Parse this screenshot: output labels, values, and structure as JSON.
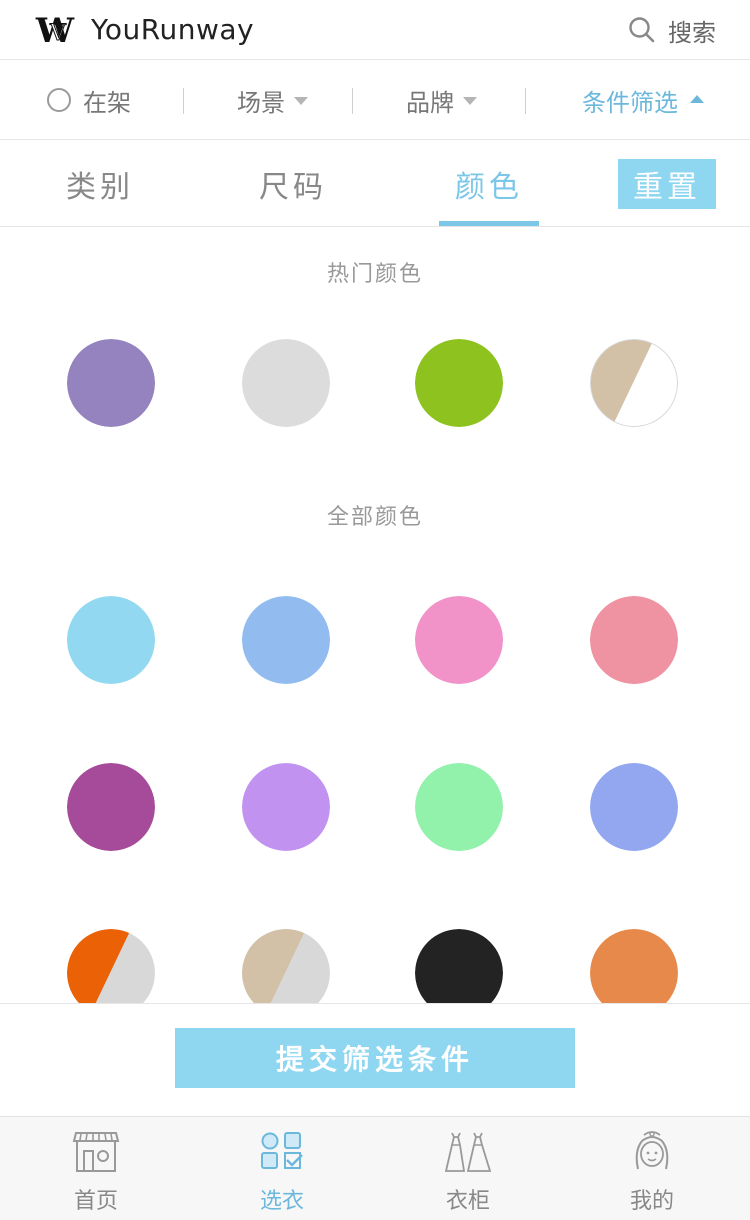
{
  "header": {
    "app_title": "YouRunway",
    "logo_icon": "yourunway-logo-icon",
    "search_label": "搜索",
    "search_icon": "search-icon"
  },
  "filter_bar": {
    "in_stock_label": "在架",
    "scene_label": "场景",
    "brand_label": "品牌",
    "conditions_label": "条件筛选"
  },
  "tabs": {
    "items": [
      {
        "label": "类别",
        "active": false
      },
      {
        "label": "尺码",
        "active": false
      },
      {
        "label": "颜色",
        "active": true
      }
    ],
    "reset_label": "重置"
  },
  "hot_colors": {
    "title": "热门颜色",
    "swatches": [
      {
        "type": "solid",
        "color": "#9483be"
      },
      {
        "type": "solid",
        "color": "#dcdcdc"
      },
      {
        "type": "solid",
        "color": "#8dc21f"
      },
      {
        "type": "split",
        "color_a": "#d2c1a7",
        "color_b": "#ffffff",
        "outlined": true
      }
    ]
  },
  "all_colors": {
    "title": "全部颜色",
    "swatches": [
      {
        "type": "solid",
        "color": "#92d8f1"
      },
      {
        "type": "solid",
        "color": "#92bcef"
      },
      {
        "type": "solid",
        "color": "#f192c9"
      },
      {
        "type": "solid",
        "color": "#ef92a2"
      },
      {
        "type": "solid",
        "color": "#a54b9a"
      },
      {
        "type": "solid",
        "color": "#c292f1"
      },
      {
        "type": "solid",
        "color": "#92f1aa"
      },
      {
        "type": "solid",
        "color": "#92a7ef"
      },
      {
        "type": "split",
        "color_a": "#eb6206",
        "color_b": "#d8d8d8",
        "outlined": false
      },
      {
        "type": "split",
        "color_a": "#d2c1a7",
        "color_b": "#d8d8d8",
        "outlined": false
      },
      {
        "type": "solid",
        "color": "#232323"
      },
      {
        "type": "solid",
        "color": "#e6894a"
      }
    ]
  },
  "submit_label": "提交筛选条件",
  "bottom_nav": {
    "items": [
      {
        "label": "首页",
        "icon": "storefront-icon",
        "active": false
      },
      {
        "label": "选衣",
        "icon": "grid-select-icon",
        "active": true
      },
      {
        "label": "衣柜",
        "icon": "dresses-icon",
        "active": false
      },
      {
        "label": "我的",
        "icon": "profile-girl-icon",
        "active": false
      }
    ]
  },
  "colors": {
    "accent": "#7cc7e8",
    "button_bg": "#8fd6f0"
  }
}
